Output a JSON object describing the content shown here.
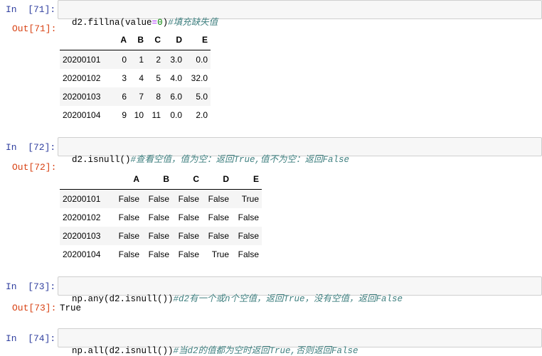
{
  "cells": [
    {
      "in_prompt": "In  [71]:",
      "code": {
        "prefix": "d2.fillna(value",
        "op": "=",
        "num": "0",
        "suffix": ")",
        "comment": "#填充缺失值"
      },
      "out_prompt": "Out[71]:",
      "table": {
        "columns": [
          "A",
          "B",
          "C",
          "D",
          "E"
        ],
        "rows": [
          {
            "index": "20200101",
            "values": [
              "0",
              "1",
              "2",
              "3.0",
              "0.0"
            ]
          },
          {
            "index": "20200102",
            "values": [
              "3",
              "4",
              "5",
              "4.0",
              "32.0"
            ]
          },
          {
            "index": "20200103",
            "values": [
              "6",
              "7",
              "8",
              "6.0",
              "5.0"
            ]
          },
          {
            "index": "20200104",
            "values": [
              "9",
              "10",
              "11",
              "0.0",
              "2.0"
            ]
          }
        ]
      }
    },
    {
      "in_prompt": "In  [72]:",
      "code": {
        "prefix": "d2.isnull()",
        "comment": "#查看空值，值为空：返回True,值不为空：返回False"
      },
      "out_prompt": "Out[72]:",
      "table": {
        "columns": [
          "A",
          "B",
          "C",
          "D",
          "E"
        ],
        "rows": [
          {
            "index": "20200101",
            "values": [
              "False",
              "False",
              "False",
              "False",
              "True"
            ]
          },
          {
            "index": "20200102",
            "values": [
              "False",
              "False",
              "False",
              "False",
              "False"
            ]
          },
          {
            "index": "20200103",
            "values": [
              "False",
              "False",
              "False",
              "False",
              "False"
            ]
          },
          {
            "index": "20200104",
            "values": [
              "False",
              "False",
              "False",
              "True",
              "False"
            ]
          }
        ]
      }
    },
    {
      "in_prompt": "In  [73]:",
      "code": {
        "prefix": "np.any(d2.isnull())",
        "comment": "#d2有一个或n个空值，返回True，没有空值，返回False"
      },
      "out_prompt": "Out[73]:",
      "output_text": "True"
    },
    {
      "in_prompt": "In  [74]:",
      "code": {
        "prefix": "np.all(d2.isnull())",
        "comment": "#当d2的值都为空时返回True,否则返回False"
      }
    }
  ]
}
